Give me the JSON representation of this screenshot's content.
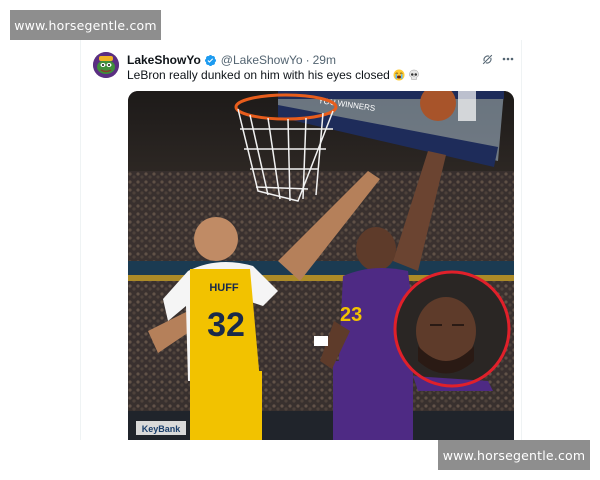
{
  "watermarks": {
    "top": "www.horsegentle.com",
    "bottom": "www.horsegentle.com"
  },
  "tweet": {
    "display_name": "LakeShowYo",
    "handle": "@LakeShowYo",
    "separator": "·",
    "time": "29m",
    "text": "LeBron really dunked on him with his eyes closed",
    "emojis": [
      "loudly-crying-face",
      "skull"
    ],
    "icons": [
      "verified-badge-icon",
      "grok-icon",
      "more-icon"
    ]
  },
  "media": {
    "jersey_name": "HUFF",
    "jersey_number": "32",
    "opponent_number": "23",
    "baseline_ad": "KeyBank",
    "backboard_text": "YOU WINNERS",
    "colors": {
      "pacers_gold": "#f2c200",
      "lakers_purple": "#4e2a84",
      "highlight_circle": "#e0202a",
      "verified_blue": "#1d9bf0"
    }
  }
}
